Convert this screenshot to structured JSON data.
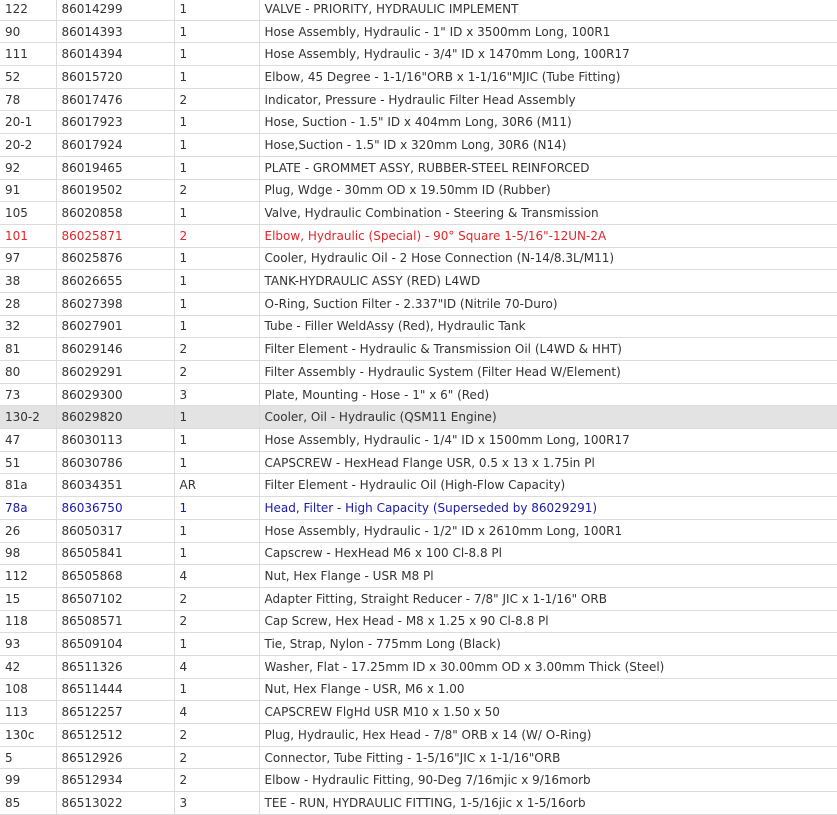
{
  "colors": {
    "red_row": "#e0262a",
    "blue_row": "#1a1aa6",
    "highlight_bg": "#e3e3e3"
  },
  "rows": [
    {
      "ref": "122",
      "part": "86014299",
      "qty": "1",
      "desc": "VALVE - PRIORITY, HYDRAULIC IMPLEMENT"
    },
    {
      "ref": "90",
      "part": "86014393",
      "qty": "1",
      "desc": "Hose Assembly, Hydraulic - 1\" ID x 3500mm Long, 100R1"
    },
    {
      "ref": "111",
      "part": "86014394",
      "qty": "1",
      "desc": "Hose Assembly, Hydraulic - 3/4\" ID x 1470mm Long, 100R17"
    },
    {
      "ref": "52",
      "part": "86015720",
      "qty": "1",
      "desc": "Elbow, 45 Degree - 1-1/16\"ORB x 1-1/16\"MJIC (Tube Fitting)"
    },
    {
      "ref": "78",
      "part": "86017476",
      "qty": "2",
      "desc": "Indicator, Pressure - Hydraulic Filter Head Assembly"
    },
    {
      "ref": "20-1",
      "part": "86017923",
      "qty": "1",
      "desc": "Hose, Suction - 1.5\" ID x 404mm Long, 30R6 (M11)"
    },
    {
      "ref": "20-2",
      "part": "86017924",
      "qty": "1",
      "desc": "Hose,Suction - 1.5\" ID x 320mm Long, 30R6 (N14)"
    },
    {
      "ref": "92",
      "part": "86019465",
      "qty": "1",
      "desc": "PLATE - GROMMET ASSY, RUBBER-STEEL REINFORCED"
    },
    {
      "ref": "91",
      "part": "86019502",
      "qty": "2",
      "desc": "Plug, Wdge - 30mm OD x 19.50mm ID (Rubber)"
    },
    {
      "ref": "105",
      "part": "86020858",
      "qty": "1",
      "desc": "Valve, Hydraulic Combination - Steering & Transmission"
    },
    {
      "ref": "101",
      "part": "86025871",
      "qty": "2",
      "desc": "Elbow, Hydraulic (Special) - 90° Square 1-5/16\"-12UN-2A",
      "style": "red"
    },
    {
      "ref": "97",
      "part": "86025876",
      "qty": "1",
      "desc": "Cooler, Hydraulic Oil - 2 Hose Connection (N-14/8.3L/M11)"
    },
    {
      "ref": "38",
      "part": "86026655",
      "qty": "1",
      "desc": "TANK-HYDRAULIC ASSY (RED) L4WD"
    },
    {
      "ref": "28",
      "part": "86027398",
      "qty": "1",
      "desc": "O-Ring, Suction Filter - 2.337\"ID (Nitrile 70-Duro)"
    },
    {
      "ref": "32",
      "part": "86027901",
      "qty": "1",
      "desc": "Tube - Filler WeldAssy (Red), Hydraulic Tank"
    },
    {
      "ref": "81",
      "part": "86029146",
      "qty": "2",
      "desc": "Filter Element - Hydraulic & Transmission Oil (L4WD & HHT)"
    },
    {
      "ref": "80",
      "part": "86029291",
      "qty": "2",
      "desc": "Filter Assembly - Hydraulic System (Filter Head W/Element)"
    },
    {
      "ref": "73",
      "part": "86029300",
      "qty": "3",
      "desc": "Plate, Mounting - Hose - 1\" x 6\" (Red)"
    },
    {
      "ref": "130-2",
      "part": "86029820",
      "qty": "1",
      "desc": "Cooler, Oil - Hydraulic (QSM11 Engine)",
      "style": "hl"
    },
    {
      "ref": "47",
      "part": "86030113",
      "qty": "1",
      "desc": "Hose Assembly, Hydraulic - 1/4\" ID x 1500mm Long, 100R17"
    },
    {
      "ref": "51",
      "part": "86030786",
      "qty": "1",
      "desc": "CAPSCREW - HexHead Flange USR, 0.5 x 13 x 1.75in Pl"
    },
    {
      "ref": "81a",
      "part": "86034351",
      "qty": "AR",
      "desc": "Filter Element - Hydraulic Oil (High-Flow Capacity)"
    },
    {
      "ref": "78a",
      "part": "86036750",
      "qty": "1",
      "desc": "Head, Filter - High Capacity (Superseded by 86029291)",
      "style": "blue"
    },
    {
      "ref": "26",
      "part": "86050317",
      "qty": "1",
      "desc": "Hose Assembly, Hydraulic - 1/2\" ID x 2610mm Long, 100R1"
    },
    {
      "ref": "98",
      "part": "86505841",
      "qty": "1",
      "desc": "Capscrew - HexHead M6 x 100 Cl-8.8 Pl"
    },
    {
      "ref": "112",
      "part": "86505868",
      "qty": "4",
      "desc": "Nut, Hex Flange - USR M8 Pl"
    },
    {
      "ref": "15",
      "part": "86507102",
      "qty": "2",
      "desc": "Adapter Fitting, Straight Reducer - 7/8\" JIC x 1-1/16\" ORB"
    },
    {
      "ref": "118",
      "part": "86508571",
      "qty": "2",
      "desc": "Cap Screw, Hex Head - M8 x 1.25 x 90 Cl-8.8 Pl"
    },
    {
      "ref": "93",
      "part": "86509104",
      "qty": "1",
      "desc": "Tie, Strap, Nylon - 775mm Long (Black)"
    },
    {
      "ref": "42",
      "part": "86511326",
      "qty": "4",
      "desc": "Washer, Flat - 17.25mm ID x 30.00mm OD x 3.00mm Thick (Steel)"
    },
    {
      "ref": "108",
      "part": "86511444",
      "qty": "1",
      "desc": "Nut, Hex Flange - USR, M6 x 1.00"
    },
    {
      "ref": "113",
      "part": "86512257",
      "qty": "4",
      "desc": "CAPSCREW FlgHd USR M10 x 1.50 x 50"
    },
    {
      "ref": "130c",
      "part": "86512512",
      "qty": "2",
      "desc": "Plug, Hydraulic, Hex Head - 7/8\" ORB x 14 (W/ O-Ring)"
    },
    {
      "ref": "5",
      "part": "86512926",
      "qty": "2",
      "desc": "Connector, Tube Fitting - 1-5/16\"JIC x 1-1/16\"ORB"
    },
    {
      "ref": "99",
      "part": "86512934",
      "qty": "2",
      "desc": "Elbow - Hydraulic Fitting, 90-Deg 7/16mjic x 9/16morb"
    },
    {
      "ref": "85",
      "part": "86513022",
      "qty": "3",
      "desc": "TEE - RUN, HYDRAULIC FITTING, 1-5/16jic x 1-5/16orb"
    }
  ]
}
